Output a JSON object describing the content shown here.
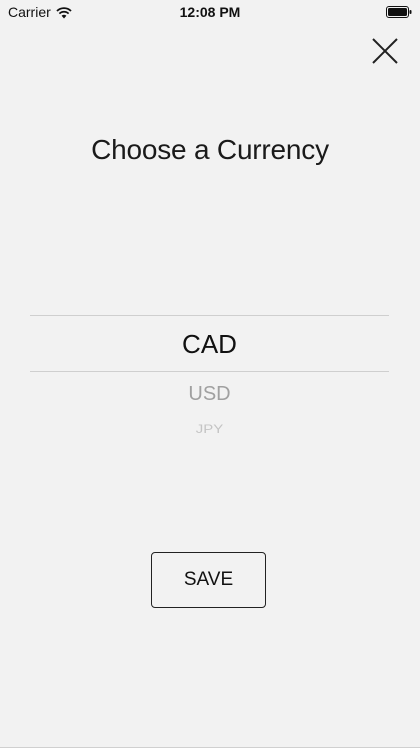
{
  "status_bar": {
    "carrier": "Carrier",
    "time": "12:08 PM",
    "wifi_icon": "wifi-icon",
    "battery_icon": "battery-icon"
  },
  "header": {
    "close_icon": "close-icon"
  },
  "main": {
    "title": "Choose a Currency",
    "picker": {
      "selected": "CAD",
      "options": [
        "CAD",
        "USD",
        "JPY"
      ]
    },
    "save_label": "SAVE"
  }
}
